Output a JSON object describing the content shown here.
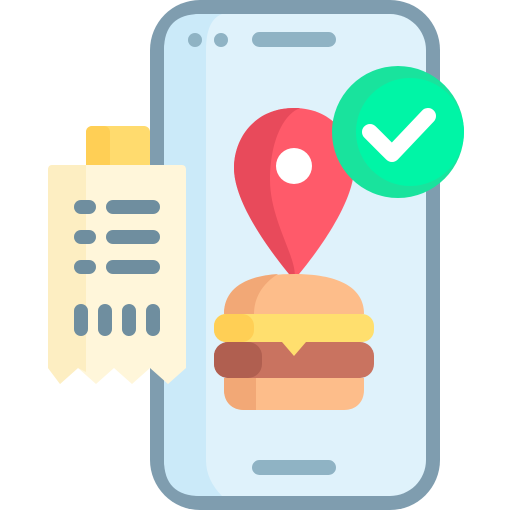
{
  "illustration": {
    "subject": "food-delivery-order-confirmed",
    "icons": [
      "smartphone-icon",
      "location-pin-icon",
      "check-badge-icon",
      "receipt-icon",
      "burger-icon"
    ],
    "colors": {
      "phone_frame": "#7f9daf",
      "phone_screen": "#dff2fb",
      "phone_screen_shade": "#cbeaf9",
      "pin": "#ff5a6a",
      "pin_shade": "#e84a5b",
      "check_badge": "#19e39d",
      "check_badge_light": "#00f5a6",
      "check_mark": "#ffffff",
      "receipt_paper": "#fff6da",
      "receipt_paper_shade": "#fdeec2",
      "receipt_clip": "#ffdb6e",
      "receipt_clip_shade": "#ffcf55",
      "receipt_lines": "#6f8e9f",
      "bun": "#fdbd8a",
      "bun_shade": "#f2a876",
      "cheese": "#ffdf6e",
      "cheese_shade": "#ffcf55",
      "patty": "#c97360",
      "patty_shade": "#b05f50"
    }
  }
}
